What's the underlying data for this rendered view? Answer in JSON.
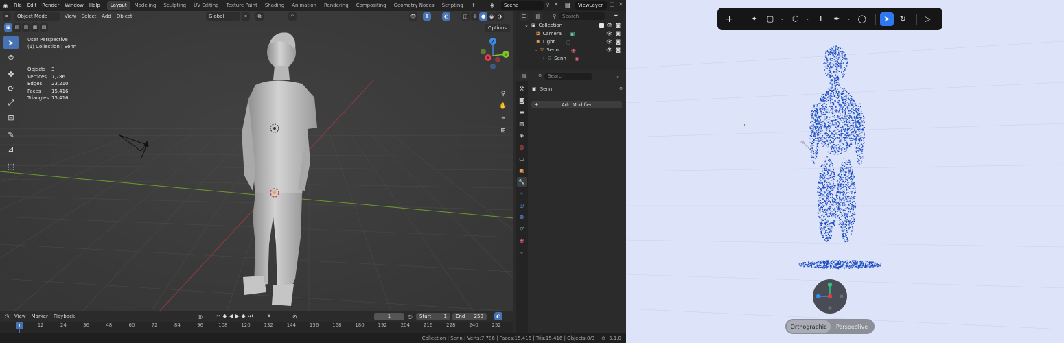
{
  "blender": {
    "menu": [
      "File",
      "Edit",
      "Render",
      "Window",
      "Help"
    ],
    "workspaces": [
      "Layout",
      "Modeling",
      "Sculpting",
      "UV Editing",
      "Texture Paint",
      "Shading",
      "Animation",
      "Rendering",
      "Compositing",
      "Geometry Nodes",
      "Scripting"
    ],
    "active_workspace": "Layout",
    "add_workspace": "+",
    "scene": "Scene",
    "view_layer": "ViewLayer",
    "viewport": {
      "mode": "Object Mode",
      "menus": [
        "View",
        "Select",
        "Add",
        "Object"
      ],
      "transform_orientation": "Global",
      "options_label": "Options",
      "perspective_label": "User Perspective",
      "collection_label": "(1) Collection | Senn",
      "stats": [
        {
          "key": "Objects",
          "value": "3"
        },
        {
          "key": "Vertices",
          "value": "7,786"
        },
        {
          "key": "Edges",
          "value": "23,210"
        },
        {
          "key": "Faces",
          "value": "15,416"
        },
        {
          "key": "Triangles",
          "value": "15,416"
        }
      ],
      "gizmo_axes": [
        "X",
        "Y",
        "Z"
      ]
    },
    "timeline": {
      "menus": [
        "View",
        "Marker",
        "Playback"
      ],
      "current_frame": "1",
      "start_label": "Start",
      "start": "1",
      "end_label": "End",
      "end": "250",
      "ruler": [
        "1",
        "12",
        "24",
        "36",
        "48",
        "60",
        "72",
        "84",
        "96",
        "108",
        "120",
        "132",
        "144",
        "156",
        "168",
        "180",
        "192",
        "204",
        "216",
        "228",
        "240",
        "252"
      ]
    },
    "statusbar": "Collection | Senn | Verts:7,786 | Faces:15,416 | Tris:15,416 | Objects:0/3 |",
    "version": "5.1.0",
    "outliner": {
      "search_placeholder": "Search",
      "items": [
        {
          "label": "Collection",
          "icon": "collection-icon",
          "color": "#e6e6e6"
        },
        {
          "label": "Camera",
          "icon": "camera-icon",
          "color": "#e8a04c"
        },
        {
          "label": "Light",
          "icon": "light-icon",
          "color": "#e8a04c"
        },
        {
          "label": "Senn",
          "icon": "mesh-object-icon",
          "color": "#e8a04c"
        },
        {
          "label": "Senn",
          "icon": "mesh-data-icon",
          "color": "#5fd38a"
        }
      ]
    },
    "properties": {
      "search_placeholder": "Search",
      "object_name": "Senn",
      "add_modifier_label": "Add Modifier",
      "add_icon": "+"
    }
  },
  "viewer": {
    "view_modes": [
      "Orthographic",
      "Perspective"
    ],
    "active_view_mode": "Orthographic"
  },
  "colors": {
    "blender_accent": "#4772b3",
    "viewer_accent": "#2f78f0",
    "point_cloud": "#1f4fc4",
    "axis_x": "#e0414f",
    "axis_y": "#7fc42b",
    "axis_z": "#3a8ee6"
  }
}
